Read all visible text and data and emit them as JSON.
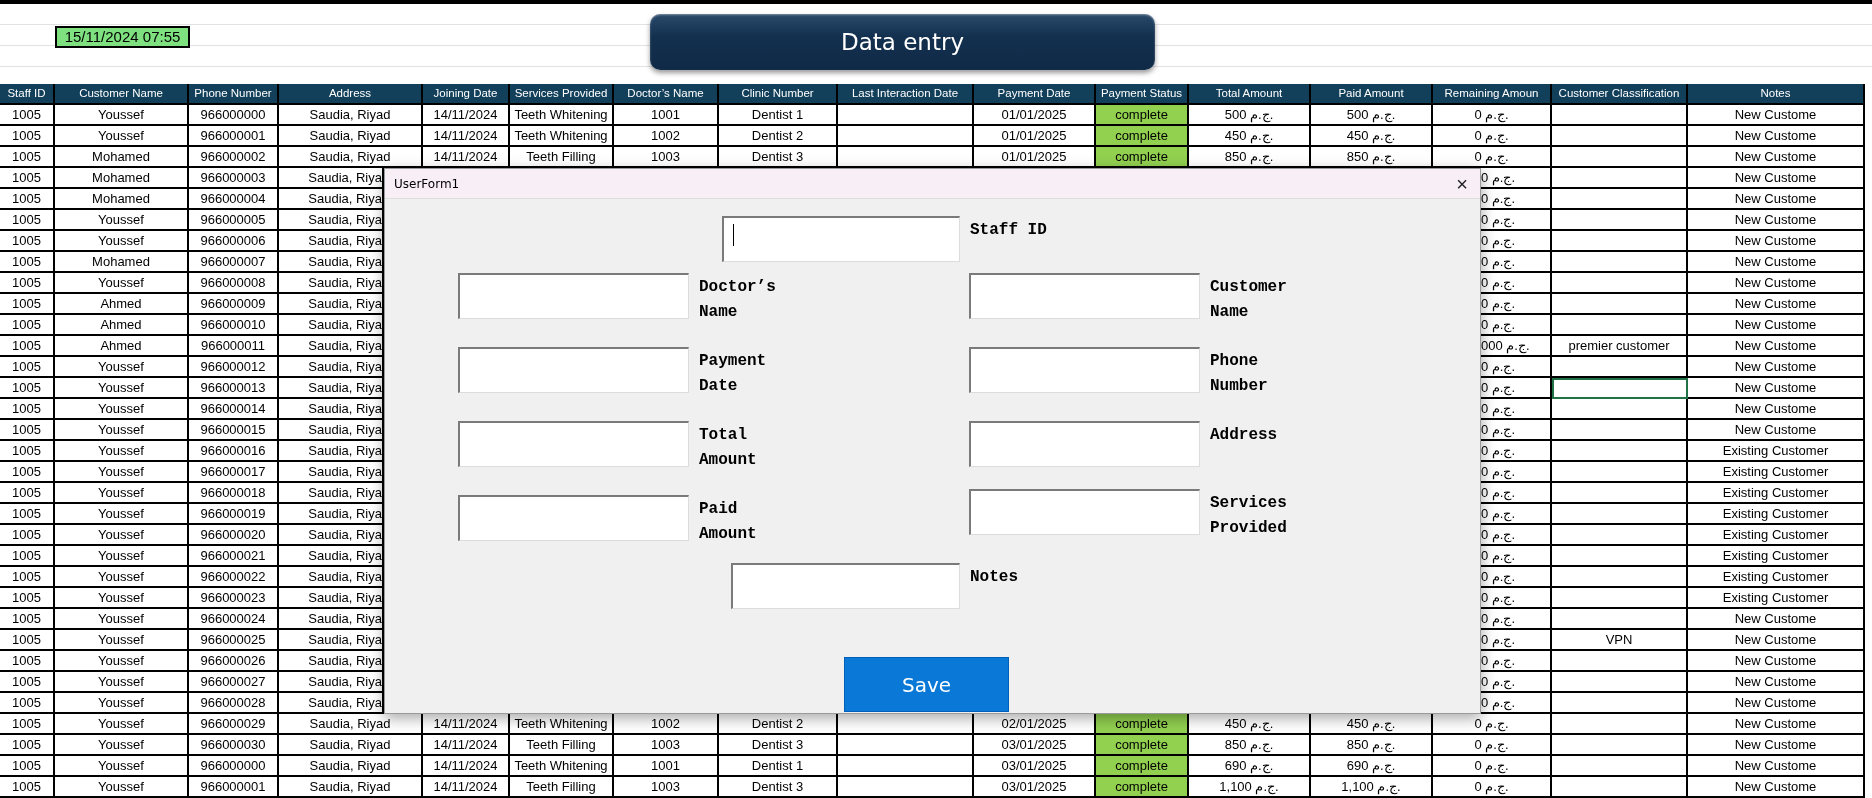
{
  "timestamp": "15/11/2024 07:55",
  "action_button": "Data entry",
  "table": {
    "columns": [
      {
        "label": "Staff ID",
        "kind": "text"
      },
      {
        "label": "Customer Name",
        "kind": "text"
      },
      {
        "label": "Phone Number",
        "kind": "text"
      },
      {
        "label": "Address",
        "kind": "text"
      },
      {
        "label": "Joining Date",
        "kind": "text"
      },
      {
        "label": "Services Provided",
        "kind": "text"
      },
      {
        "label": "Doctor’s Name",
        "kind": "text"
      },
      {
        "label": "Clinic Number",
        "kind": "text"
      },
      {
        "label": "Last Interaction Date",
        "kind": "text"
      },
      {
        "label": "Payment Date",
        "kind": "text"
      },
      {
        "label": "Payment Status",
        "kind": "status"
      },
      {
        "label": "Total Amount",
        "kind": "text"
      },
      {
        "label": "Paid Amount",
        "kind": "text"
      },
      {
        "label": "Remaining Amoun",
        "kind": "text"
      },
      {
        "label": "Customer Classification",
        "kind": "text"
      },
      {
        "label": "Notes",
        "kind": "text"
      }
    ],
    "rows": [
      {
        "covered": false,
        "selected": false,
        "cells": [
          "1005",
          "Youssef",
          "966000000",
          "Saudia, Riyad",
          "14/11/2024",
          "Teeth Whitening",
          "1001",
          "Dentist 1",
          null,
          "01/01/2025",
          "complete",
          "500 ج.م.",
          "500 ج.م.",
          "0 ج.م.",
          null,
          "New Custome"
        ]
      },
      {
        "covered": false,
        "selected": false,
        "cells": [
          "1005",
          "Youssef",
          "966000001",
          "Saudia, Riyad",
          "14/11/2024",
          "Teeth Whitening",
          "1002",
          "Dentist 2",
          null,
          "01/01/2025",
          "complete",
          "450 ج.م.",
          "450 ج.م.",
          "0 ج.م.",
          null,
          "New Custome"
        ]
      },
      {
        "covered": false,
        "selected": false,
        "cells": [
          "1005",
          "Mohamed",
          "966000002",
          "Saudia, Riyad",
          "14/11/2024",
          "Teeth Filling",
          "1003",
          "Dentist 3",
          null,
          "01/01/2025",
          "complete",
          "850 ج.م.",
          "850 ج.م.",
          "0 ج.م.",
          null,
          "New Custome"
        ]
      },
      {
        "covered": true,
        "selected": false,
        "cells": [
          "1005",
          "Mohamed",
          "966000003",
          "Saudia, Riya",
          "0 ج.م.",
          null,
          "New Custome"
        ]
      },
      {
        "covered": true,
        "selected": false,
        "cells": [
          "1005",
          "Mohamed",
          "966000004",
          "Saudia, Riya",
          "0 ج.م.",
          null,
          "New Custome"
        ]
      },
      {
        "covered": true,
        "selected": false,
        "cells": [
          "1005",
          "Youssef",
          "966000005",
          "Saudia, Riya",
          "0 ج.م.",
          null,
          "New Custome"
        ]
      },
      {
        "covered": true,
        "selected": false,
        "cells": [
          "1005",
          "Youssef",
          "966000006",
          "Saudia, Riya",
          "0 ج.م.",
          null,
          "New Custome"
        ]
      },
      {
        "covered": true,
        "selected": false,
        "cells": [
          "1005",
          "Mohamed",
          "966000007",
          "Saudia, Riya",
          "0 ج.م.",
          null,
          "New Custome"
        ]
      },
      {
        "covered": true,
        "selected": false,
        "cells": [
          "1005",
          "Youssef",
          "966000008",
          "Saudia, Riya",
          "0 ج.م.",
          null,
          "New Custome"
        ]
      },
      {
        "covered": true,
        "selected": false,
        "cells": [
          "1005",
          "Ahmed",
          "966000009",
          "Saudia, Riya",
          "0 ج.م.",
          null,
          "New Custome"
        ]
      },
      {
        "covered": true,
        "selected": false,
        "cells": [
          "1005",
          "Ahmed",
          "966000010",
          "Saudia, Riya",
          "0 ج.م.",
          null,
          "New Custome"
        ]
      },
      {
        "covered": true,
        "selected": false,
        "cells": [
          "1005",
          "Ahmed",
          "966000011",
          "Saudia, Riya",
          "000 ج.م.",
          "premier customer",
          "New Custome"
        ]
      },
      {
        "covered": true,
        "selected": false,
        "cells": [
          "1005",
          "Youssef",
          "966000012",
          "Saudia, Riya",
          "0 ج.م.",
          null,
          "New Custome"
        ]
      },
      {
        "covered": true,
        "selected": true,
        "cells": [
          "1005",
          "Youssef",
          "966000013",
          "Saudia, Riya",
          "0 ج.م.",
          null,
          "New Custome"
        ]
      },
      {
        "covered": true,
        "selected": false,
        "cells": [
          "1005",
          "Youssef",
          "966000014",
          "Saudia, Riya",
          "0 ج.م.",
          null,
          "New Custome"
        ]
      },
      {
        "covered": true,
        "selected": false,
        "cells": [
          "1005",
          "Youssef",
          "966000015",
          "Saudia, Riya",
          "0 ج.م.",
          null,
          "New Custome"
        ]
      },
      {
        "covered": true,
        "selected": false,
        "cells": [
          "1005",
          "Youssef",
          "966000016",
          "Saudia, Riya",
          "0 ج.م.",
          null,
          "Existing Customer"
        ]
      },
      {
        "covered": true,
        "selected": false,
        "cells": [
          "1005",
          "Youssef",
          "966000017",
          "Saudia, Riya",
          "0 ج.م.",
          null,
          "Existing Customer"
        ]
      },
      {
        "covered": true,
        "selected": false,
        "cells": [
          "1005",
          "Youssef",
          "966000018",
          "Saudia, Riya",
          "0 ج.م.",
          null,
          "Existing Customer"
        ]
      },
      {
        "covered": true,
        "selected": false,
        "cells": [
          "1005",
          "Youssef",
          "966000019",
          "Saudia, Riya",
          "0 ج.م.",
          null,
          "Existing Customer"
        ]
      },
      {
        "covered": true,
        "selected": false,
        "cells": [
          "1005",
          "Youssef",
          "966000020",
          "Saudia, Riya",
          "0 ج.م.",
          null,
          "Existing Customer"
        ]
      },
      {
        "covered": true,
        "selected": false,
        "cells": [
          "1005",
          "Youssef",
          "966000021",
          "Saudia, Riya",
          "0 ج.م.",
          null,
          "Existing Customer"
        ]
      },
      {
        "covered": true,
        "selected": false,
        "cells": [
          "1005",
          "Youssef",
          "966000022",
          "Saudia, Riya",
          "0 ج.م.",
          null,
          "Existing Customer"
        ]
      },
      {
        "covered": true,
        "selected": false,
        "cells": [
          "1005",
          "Youssef",
          "966000023",
          "Saudia, Riya",
          "0 ج.م.",
          null,
          "Existing Customer"
        ]
      },
      {
        "covered": true,
        "selected": false,
        "cells": [
          "1005",
          "Youssef",
          "966000024",
          "Saudia, Riya",
          "0 ج.م.",
          null,
          "New Custome"
        ]
      },
      {
        "covered": true,
        "selected": false,
        "cells": [
          "1005",
          "Youssef",
          "966000025",
          "Saudia, Riya",
          "0 ج.م.",
          "VPN",
          "New Custome"
        ]
      },
      {
        "covered": true,
        "selected": false,
        "cells": [
          "1005",
          "Youssef",
          "966000026",
          "Saudia, Riya",
          "0 ج.م.",
          null,
          "New Custome"
        ]
      },
      {
        "covered": true,
        "selected": false,
        "cells": [
          "1005",
          "Youssef",
          "966000027",
          "Saudia, Riya",
          "0 ج.م.",
          null,
          "New Custome"
        ]
      },
      {
        "covered": true,
        "selected": false,
        "cells": [
          "1005",
          "Youssef",
          "966000028",
          "Saudia, Riya",
          "0 ج.م.",
          null,
          "New Custome"
        ]
      },
      {
        "covered": false,
        "selected": false,
        "cells": [
          "1005",
          "Youssef",
          "966000029",
          "Saudia, Riyad",
          "14/11/2024",
          "Teeth Whitening",
          "1002",
          "Dentist 2",
          null,
          "02/01/2025",
          "complete",
          "450 ج.م.",
          "450 ج.م.",
          "0 ج.م.",
          null,
          "New Custome"
        ]
      },
      {
        "covered": false,
        "selected": false,
        "cells": [
          "1005",
          "Youssef",
          "966000030",
          "Saudia, Riyad",
          "14/11/2024",
          "Teeth Filling",
          "1003",
          "Dentist 3",
          null,
          "03/01/2025",
          "complete",
          "850 ج.م.",
          "850 ج.م.",
          "0 ج.م.",
          null,
          "New Custome"
        ]
      },
      {
        "covered": false,
        "selected": false,
        "cells": [
          "1005",
          "Youssef",
          "966000000",
          "Saudia, Riyad",
          "14/11/2024",
          "Teeth Whitening",
          "1001",
          "Dentist 1",
          null,
          "03/01/2025",
          "complete",
          "690 ج.م.",
          "690 ج.م.",
          "0 ج.م.",
          null,
          "New Custome"
        ]
      },
      {
        "covered": false,
        "selected": false,
        "cells": [
          "1005",
          "Youssef",
          "966000001",
          "Saudia, Riyad",
          "14/11/2024",
          "Teeth Filling",
          "1003",
          "Dentist 3",
          null,
          "03/01/2025",
          "complete",
          "1,100 ج.م.",
          "1,100 ج.م.",
          "0 ج.م.",
          null,
          "New Custome"
        ]
      }
    ]
  },
  "form": {
    "title": "UserForm1",
    "close": "×",
    "top_field": {
      "label": "Staff ID",
      "focused": true
    },
    "left_fields": [
      {
        "label": "Doctor’s Name",
        "focused": false
      },
      {
        "label": "Payment Date",
        "focused": false
      },
      {
        "label": "Total Amount",
        "focused": false
      },
      {
        "label": "Paid Amount",
        "focused": false
      }
    ],
    "right_fields": [
      {
        "label": "Customer Name",
        "focused": false
      },
      {
        "label": "Phone Number",
        "focused": false
      },
      {
        "label": "Address",
        "focused": false
      },
      {
        "label": "Services Provided",
        "focused": false
      }
    ],
    "bottom_field": {
      "label": "Notes",
      "focused": false
    },
    "save_button": "Save"
  }
}
